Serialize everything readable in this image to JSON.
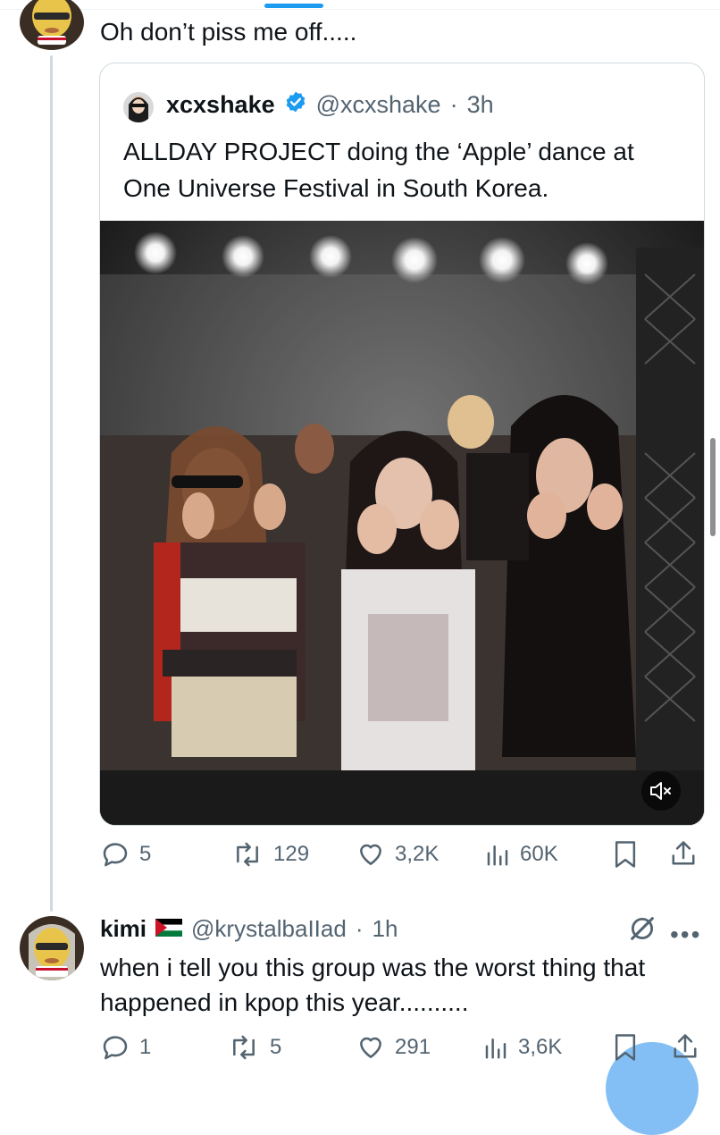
{
  "colors": {
    "accent": "#1d9bf0",
    "text": "#0f1419",
    "muted": "#536471",
    "border": "#cfd9de"
  },
  "reply1": {
    "text": "Oh don’t piss me off....."
  },
  "quote": {
    "display_name": "xcxshake",
    "verified": true,
    "handle": "@xcxshake",
    "time": "3h",
    "text": "ALLDAY PROJECT doing the ‘Apple’ dance at One Universe Festival in South Korea.",
    "media": {
      "type": "video",
      "muted_icon": "speaker-muted-icon"
    }
  },
  "actions1": {
    "replies": "5",
    "reposts": "129",
    "likes": "3,2K",
    "views": "60K"
  },
  "reply2": {
    "display_name": "kimi",
    "flag_icon": "palestine-flag-icon",
    "handle": "@krystalbaIIad",
    "time": "1h",
    "text": "when i tell you this group was the worst thing that happened in kpop this year.........."
  },
  "actions2": {
    "replies": "1",
    "reposts": "5",
    "likes": "291",
    "views": "3,6K"
  }
}
